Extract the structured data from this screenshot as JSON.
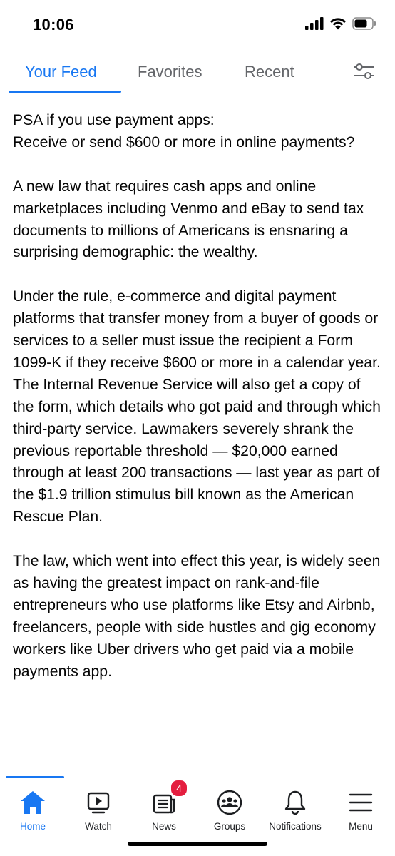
{
  "status_bar": {
    "time": "10:06"
  },
  "feed_tabs": {
    "items": [
      {
        "label": "Your Feed"
      },
      {
        "label": "Favorites"
      },
      {
        "label": "Recent"
      }
    ],
    "active_index": 0
  },
  "post": {
    "paragraphs": [
      "PSA if you use payment apps:\nReceive or send $600 or more in online payments?",
      "A new law that requires cash apps and online marketplaces including Venmo and eBay to send tax documents to millions of Americans is ensnaring a surprising demographic: the wealthy.",
      "Under the rule, e-commerce and digital payment platforms that transfer money from a buyer of goods or services to a seller must issue the recipient a Form 1099-K if they receive $600 or more in a calendar year. The Internal Revenue Service will also get a copy of the form, which details who got paid and through which third-party service. Lawmakers severely shrank the previous reportable threshold — $20,000 earned through at least 200 transactions — last year as part of the $1.9 trillion stimulus bill known as the American Rescue Plan.",
      "The law, which went into effect this year, is widely seen as having the greatest impact on rank-and-file entrepreneurs who use platforms like Etsy and Airbnb, freelancers, people with side hustles and gig economy workers like Uber drivers who get paid via a mobile payments app."
    ]
  },
  "bottom_nav": {
    "items": [
      {
        "label": "Home",
        "icon": "home-icon"
      },
      {
        "label": "Watch",
        "icon": "watch-icon"
      },
      {
        "label": "News",
        "icon": "news-icon",
        "badge": "4"
      },
      {
        "label": "Groups",
        "icon": "groups-icon"
      },
      {
        "label": "Notifications",
        "icon": "bell-icon"
      },
      {
        "label": "Menu",
        "icon": "menu-icon"
      }
    ],
    "active_index": 0
  },
  "colors": {
    "accent": "#1877f2",
    "badge": "#e41e3f",
    "text": "#050505",
    "secondary_text": "#65676b"
  }
}
